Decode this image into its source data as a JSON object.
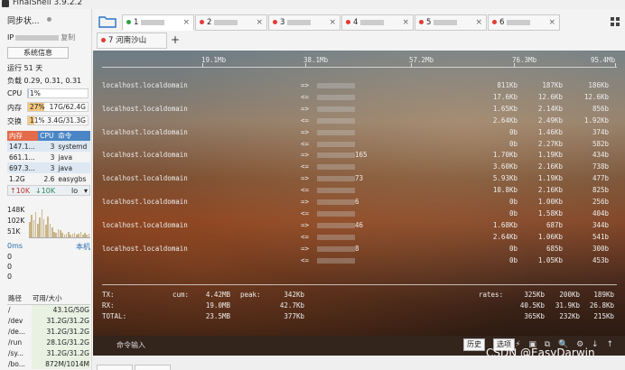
{
  "window": {
    "title": "FinalShell 3.9.2.2"
  },
  "sidebar": {
    "sync_status": "同步状...",
    "ip_label": "IP",
    "copy_label": "复制",
    "sysinfo_button": "系统信息",
    "uptime": "运行 51 天",
    "load": "负载 0.29, 0.31, 0.31",
    "cpu": {
      "label": "CPU",
      "text": "1%",
      "percent": 1
    },
    "memory": {
      "label": "内存",
      "percent_text": "27%",
      "usage": "17G/62.4G",
      "percent": 27
    },
    "swap": {
      "label": "交换",
      "percent_text": "11%",
      "usage": "3.4G/31.3G",
      "percent": 11
    },
    "process_headers": [
      "内存",
      "CPU",
      "命令"
    ],
    "processes": [
      {
        "mem": "147.1...",
        "cpu": "3",
        "cmd": "systemd"
      },
      {
        "mem": "661.1...",
        "cpu": "3",
        "cmd": "java"
      },
      {
        "mem": "697.3...",
        "cpu": "3",
        "cmd": "java"
      },
      {
        "mem": "1.2G",
        "cpu": "2.6",
        "cmd": "easygbs"
      }
    ],
    "disk_io": {
      "up": "↑10K",
      "down": "↓10K",
      "target": "lo",
      "chevron": "▾"
    },
    "net_axis": [
      "148K",
      "102K",
      "51K"
    ],
    "net_bars": [
      0.55,
      0.8,
      0.6,
      0.9,
      0.5,
      0.7,
      1.0,
      0.65,
      0.45,
      0.75,
      0.5,
      0.35,
      0.2,
      0.15,
      0.3,
      0.25,
      0.15,
      0.1,
      0.12,
      0.18,
      0.1,
      0.12,
      0.15,
      0.1,
      0.12,
      0.2,
      0.1,
      0.15,
      0.1,
      0.12
    ],
    "ping": {
      "ms": "0ms",
      "host": "本机",
      "values": [
        "0",
        "0",
        "0"
      ]
    },
    "disk_headers": [
      "路径",
      "可用/大小"
    ],
    "disks": [
      {
        "path": "/",
        "size": "43.1G/50G"
      },
      {
        "path": "/dev",
        "size": "31.2G/31.2G"
      },
      {
        "path": "/de...",
        "size": "31.2G/31.2G"
      },
      {
        "path": "/run",
        "size": "28.1G/31.2G"
      },
      {
        "path": "/sy...",
        "size": "31.2G/31.2G"
      },
      {
        "path": "/bo...",
        "size": "872M/1014M"
      }
    ]
  },
  "tabs": [
    {
      "num": "1",
      "active": true,
      "dot": "green"
    },
    {
      "num": "2",
      "active": false,
      "dot": "red"
    },
    {
      "num": "3",
      "active": false,
      "dot": "red"
    },
    {
      "num": "4",
      "active": false,
      "dot": "red"
    },
    {
      "num": "5",
      "active": false,
      "dot": "red"
    },
    {
      "num": "6",
      "active": false,
      "dot": "red"
    }
  ],
  "tab7": {
    "label": "7 河南沙山"
  },
  "tab_close": "×",
  "plus": "+",
  "terminal": {
    "scale": [
      "19.1Mb",
      "38.1Mb",
      "57.2Mb",
      "76.3Mb",
      "95.4Mb"
    ],
    "rows": [
      {
        "host": "localhost.localdomain",
        "arrow": "=>",
        "port": "",
        "c1": "811Kb",
        "c2": "187Kb",
        "c3": "186Kb"
      },
      {
        "host": "",
        "arrow": "<=",
        "port": "",
        "c1": "17.6Kb",
        "c2": "12.6Kb",
        "c3": "12.6Kb"
      },
      {
        "host": "localhost.localdomain",
        "arrow": "=>",
        "port": "",
        "c1": "1.65Kb",
        "c2": "2.14Kb",
        "c3": "856b"
      },
      {
        "host": "",
        "arrow": "<=",
        "port": "",
        "c1": "2.64Kb",
        "c2": "2.49Kb",
        "c3": "1.92Kb"
      },
      {
        "host": "localhost.localdomain",
        "arrow": "=>",
        "port": "",
        "c1": "0b",
        "c2": "1.46Kb",
        "c3": "374b"
      },
      {
        "host": "",
        "arrow": "<=",
        "port": "",
        "c1": "0b",
        "c2": "2.27Kb",
        "c3": "582b"
      },
      {
        "host": "localhost.localdomain",
        "arrow": "=>",
        "port": "165",
        "c1": "1.70Kb",
        "c2": "1.19Kb",
        "c3": "434b"
      },
      {
        "host": "",
        "arrow": "<=",
        "port": "",
        "c1": "3.60Kb",
        "c2": "2.16Kb",
        "c3": "738b"
      },
      {
        "host": "localhost.localdomain",
        "arrow": "=>",
        "port": "73",
        "c1": "5.93Kb",
        "c2": "1.19Kb",
        "c3": "477b"
      },
      {
        "host": "",
        "arrow": "<=",
        "port": "",
        "c1": "10.8Kb",
        "c2": "2.16Kb",
        "c3": "825b"
      },
      {
        "host": "localhost.localdomain",
        "arrow": "=>",
        "port": "6",
        "c1": "0b",
        "c2": "1.00Kb",
        "c3": "256b"
      },
      {
        "host": "",
        "arrow": "<=",
        "port": "",
        "c1": "0b",
        "c2": "1.58Kb",
        "c3": "404b"
      },
      {
        "host": "localhost.localdomain",
        "arrow": "=>",
        "port": "46",
        "c1": "1.68Kb",
        "c2": "687b",
        "c3": "344b"
      },
      {
        "host": "",
        "arrow": "<=",
        "port": "",
        "c1": "2.64Kb",
        "c2": "1.06Kb",
        "c3": "541b"
      },
      {
        "host": "localhost.localdomain",
        "arrow": "=>",
        "port": "8",
        "c1": "0b",
        "c2": "685b",
        "c3": "300b"
      },
      {
        "host": "",
        "arrow": "<=",
        "port": "",
        "c1": "0b",
        "c2": "1.05Kb",
        "c3": "453b"
      }
    ],
    "totals": [
      {
        "label": "TX:",
        "cum_label": "cum:",
        "cum": "4.42MB",
        "peak_label": "peak:",
        "peak": "342Kb",
        "rates_label": "rates:",
        "r1": "325Kb",
        "r2": "200Kb",
        "r3": "189Kb"
      },
      {
        "label": "RX:",
        "cum_label": "",
        "cum": "19.0MB",
        "peak_label": "",
        "peak": "42.7Kb",
        "rates_label": "",
        "r1": "40.5Kb",
        "r2": "31.9Kb",
        "r3": "26.8Kb"
      },
      {
        "label": "TOTAL:",
        "cum_label": "",
        "cum": "23.5MB",
        "peak_label": "",
        "peak": "377Kb",
        "rates_label": "",
        "r1": "365Kb",
        "r2": "232Kb",
        "r3": "215Kb"
      }
    ]
  },
  "command": {
    "placeholder": "命令输入",
    "history": "历史",
    "options": "选项",
    "icons": "⚡ ▣ ⧉ 🔍 ⚙ ↓ ↑"
  },
  "watermark": "CSDN @EasyDarwin"
}
